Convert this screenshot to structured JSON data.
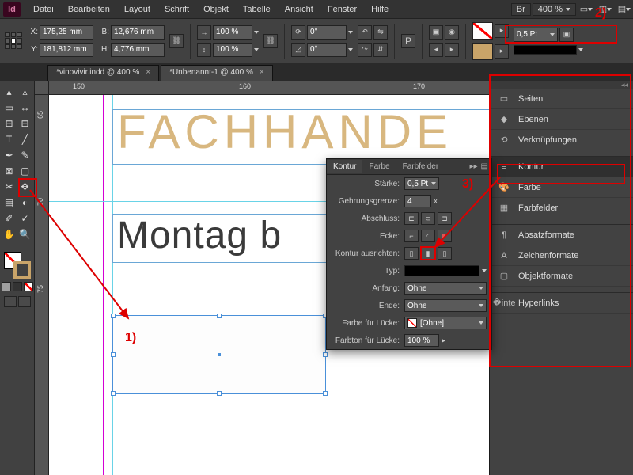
{
  "menubar": {
    "items": [
      "Datei",
      "Bearbeiten",
      "Layout",
      "Schrift",
      "Objekt",
      "Tabelle",
      "Ansicht",
      "Fenster",
      "Hilfe"
    ],
    "br": "Br",
    "zoom": "400 %"
  },
  "controlbar": {
    "x": "175,25 mm",
    "y": "181,812 mm",
    "w": "12,676 mm",
    "h": "4,776 mm",
    "scaleX": "100 %",
    "scaleY": "100 %",
    "rotate": "0°",
    "shear": "0°",
    "strokeWeight": "0,5 Pt"
  },
  "tabs": [
    {
      "label": "*vinovivir.indd @ 400 %",
      "active": false
    },
    {
      "label": "*Unbenannt-1 @ 400 %",
      "active": true
    }
  ],
  "ruler": {
    "h": [
      "150",
      "160",
      "170"
    ],
    "v": [
      "65",
      "70",
      "75"
    ]
  },
  "canvasText": {
    "headline": "FACHHANDE",
    "line2": "Montag b"
  },
  "strokePanel": {
    "tabs": [
      "Kontur",
      "Farbe",
      "Farbfelder"
    ],
    "rows": {
      "weight_label": "Stärke:",
      "weight": "0,5 Pt",
      "miter_label": "Gehrungsgrenze:",
      "miter": "4",
      "miter_suffix": "x",
      "cap_label": "Abschluss:",
      "join_label": "Ecke:",
      "align_label": "Kontur ausrichten:",
      "type_label": "Typ:",
      "start_label": "Anfang:",
      "start": "Ohne",
      "end_label": "Ende:",
      "end": "Ohne",
      "gapColor_label": "Farbe für Lücke:",
      "gapColor": "[Ohne]",
      "gapTint_label": "Farbton für Lücke:",
      "gapTint": "100 %"
    }
  },
  "panels": [
    {
      "icon": "pages",
      "label": "Seiten"
    },
    {
      "icon": "layers",
      "label": "Ebenen"
    },
    {
      "icon": "links",
      "label": "Verknüpfungen"
    },
    {
      "sep": true
    },
    {
      "icon": "stroke",
      "label": "Kontur",
      "active": true
    },
    {
      "icon": "color",
      "label": "Farbe"
    },
    {
      "icon": "swatches",
      "label": "Farbfelder"
    },
    {
      "sep": true
    },
    {
      "icon": "para",
      "label": "Absatzformate"
    },
    {
      "icon": "char",
      "label": "Zeichenformate"
    },
    {
      "icon": "obj",
      "label": "Objektformate"
    },
    {
      "sep": true
    },
    {
      "icon": "links2",
      "label": "Hyperlinks"
    }
  ],
  "annotations": {
    "l1": "1)",
    "l2": "2)",
    "l3": "3)"
  }
}
